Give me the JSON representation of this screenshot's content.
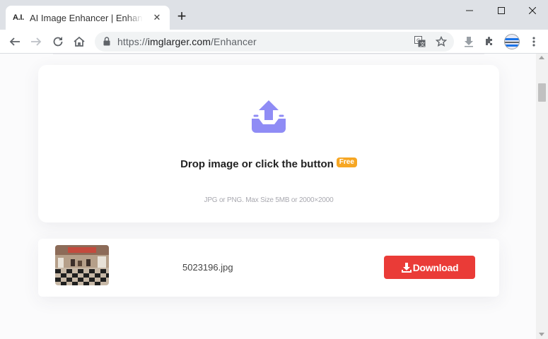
{
  "tab": {
    "favicon_text": "A.I.",
    "title": "AI Image Enhancer | Enhance photo quality online"
  },
  "toolbar": {
    "url_scheme": "https://",
    "url_host": "imglarger.com",
    "url_path": "/Enhancer"
  },
  "upload": {
    "title": "Drop image or click the button",
    "badge": "Free",
    "hint": "JPG or PNG. Max Size 5MB or 2000×2000"
  },
  "file": {
    "name": "5023196.jpg",
    "download_label": "Download"
  },
  "colors": {
    "upload_icon": "#8f8cf5",
    "badge": "#f6a623",
    "download_button": "#ea3b37"
  },
  "icons": [
    "back-icon",
    "forward-icon",
    "reload-icon",
    "home-icon",
    "lock-icon",
    "translate-icon",
    "star-icon",
    "download-indicator-icon",
    "extensions-icon",
    "profile-avatar",
    "menu-icon",
    "upload-icon",
    "download-icon"
  ]
}
